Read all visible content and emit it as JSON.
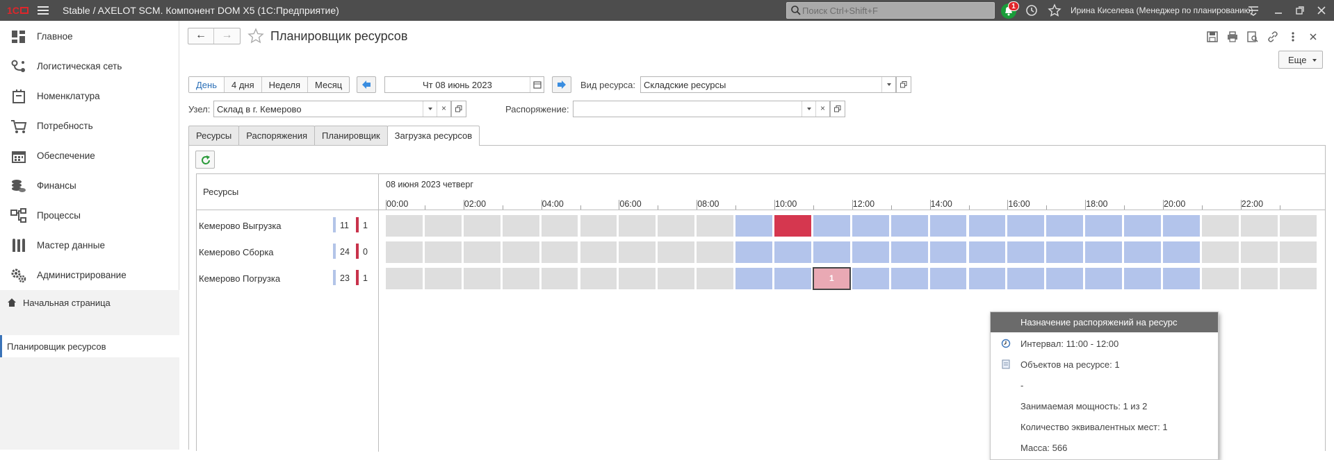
{
  "app": {
    "title": "Stable / AXELOT SCM. Компонент DOM X5  (1С:Предприятие)",
    "search_placeholder": "Поиск Ctrl+Shift+F",
    "notifications_count": "1",
    "user": "Ирина Киселева (Менеджер по планированию)",
    "accent": "#3a73b8"
  },
  "sidebar": {
    "items": [
      {
        "label": "Главное",
        "icon": "grid-icon"
      },
      {
        "label": "Логистическая сеть",
        "icon": "network-icon"
      },
      {
        "label": "Номенклатура",
        "icon": "box-icon"
      },
      {
        "label": "Потребность",
        "icon": "cart-icon"
      },
      {
        "label": "Обеспечение",
        "icon": "calendar-icon"
      },
      {
        "label": "Финансы",
        "icon": "coins-icon"
      },
      {
        "label": "Процессы",
        "icon": "process-icon"
      },
      {
        "label": "Мастер данные",
        "icon": "bars-icon"
      },
      {
        "label": "Администрирование",
        "icon": "gears-icon"
      }
    ],
    "home": "Начальная страница",
    "open_tab": "Планировщик ресурсов"
  },
  "page": {
    "title": "Планировщик ресурсов",
    "more": "Еще"
  },
  "filters": {
    "periods": [
      "День",
      "4 дня",
      "Неделя",
      "Месяц"
    ],
    "active_period": "День",
    "date": "Чт 08 июнь 2023",
    "resource_type_label": "Вид ресурса:",
    "resource_type": "Складские ресурсы",
    "node_label": "Узел:",
    "node": "Склад в г. Кемерово",
    "order_label": "Распоряжение:",
    "order": ""
  },
  "tabs": [
    "Ресурсы",
    "Распоряжения",
    "Планировщик",
    "Загрузка ресурсов"
  ],
  "active_tab": "Загрузка ресурсов",
  "grid": {
    "resources_header": "Ресурсы",
    "date_header": "08 июня 2023 четверг",
    "hours": [
      "00:00",
      "02:00",
      "04:00",
      "06:00",
      "08:00",
      "10:00",
      "12:00",
      "14:00",
      "16:00",
      "18:00",
      "20:00",
      "22:00"
    ],
    "rows": [
      {
        "name": "Кемерово Выгрузка",
        "free": "11",
        "busy": "1",
        "slots": [
          "g",
          "g",
          "g",
          "g",
          "g",
          "g",
          "g",
          "g",
          "g",
          "b",
          "r",
          "b",
          "b",
          "b",
          "b",
          "b",
          "b",
          "b",
          "b",
          "b",
          "b",
          "g",
          "g",
          "g"
        ]
      },
      {
        "name": "Кемерово Сборка",
        "free": "24",
        "busy": "0",
        "slots": [
          "g",
          "g",
          "g",
          "g",
          "g",
          "g",
          "g",
          "g",
          "g",
          "b",
          "b",
          "b",
          "b",
          "b",
          "b",
          "b",
          "b",
          "b",
          "b",
          "b",
          "b",
          "g",
          "g",
          "g"
        ]
      },
      {
        "name": "Кемерово Погрузка",
        "free": "23",
        "busy": "1",
        "slots": [
          "g",
          "g",
          "g",
          "g",
          "g",
          "g",
          "g",
          "g",
          "g",
          "b",
          "b",
          "p",
          "b",
          "b",
          "b",
          "b",
          "b",
          "b",
          "b",
          "b",
          "b",
          "g",
          "g",
          "g"
        ],
        "selected_slot": 11,
        "selected_label": "1"
      }
    ],
    "colors": {
      "free": "#dedede",
      "available": "#b3c4eb",
      "busy": "#d5374f",
      "partial": "#e9a9b4"
    }
  },
  "popup": {
    "header": "Назначение распоряжений на ресурс",
    "interval": "Интервал: 11:00 - 12:00",
    "objects": "Объектов на ресурсе: 1",
    "dash": "-",
    "capacity": "Занимаемая мощность: 1 из 2",
    "places": "Количество эквивалентных мест: 1",
    "mass": "Масса: 566"
  }
}
